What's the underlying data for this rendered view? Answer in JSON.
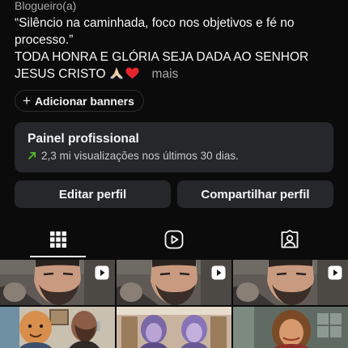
{
  "profile": {
    "category": "Blogueiro(a)",
    "bio_lines": [
      "“Silêncio na caminhada, foco nos objetivos e fé no",
      "processo.”",
      "TODA HONRA E GLÓRIA SEJA DADA AO SENHOR",
      "JESUS CRISTO"
    ],
    "bio_emojis": [
      "praying-hands",
      "red-heart"
    ],
    "more_label": "mais"
  },
  "banner_button": {
    "icon": "plus-icon",
    "label": "Adicionar banners"
  },
  "professional_panel": {
    "title": "Painel profissional",
    "stats_icon": "trending-up-arrow-icon",
    "stats": "2,3 mi visualizações nos últimos 30 dias.",
    "accent_color": "#58c322"
  },
  "actions": {
    "edit_label": "Editar perfil",
    "share_label": "Compartilhar perfil"
  },
  "tabs": [
    {
      "icon": "grid-icon",
      "active": true
    },
    {
      "icon": "reels-icon",
      "active": false
    },
    {
      "icon": "tagged-icon",
      "active": false
    }
  ],
  "posts": [
    {
      "thumbnail": "man-with-beard",
      "type": "reel"
    },
    {
      "thumbnail": "man-with-beard",
      "type": "reel"
    },
    {
      "thumbnail": "man-with-beard",
      "type": "reel"
    },
    {
      "thumbnail": "cartoon-two-men-office",
      "type": "image"
    },
    {
      "thumbnail": "cartoon-two-women-corridor",
      "type": "image"
    },
    {
      "thumbnail": "cartoon-woman-office",
      "type": "image"
    }
  ],
  "colors": {
    "background": "#0b0b0c",
    "card": "#26272a",
    "secondary_text": "#a8a8a8"
  }
}
